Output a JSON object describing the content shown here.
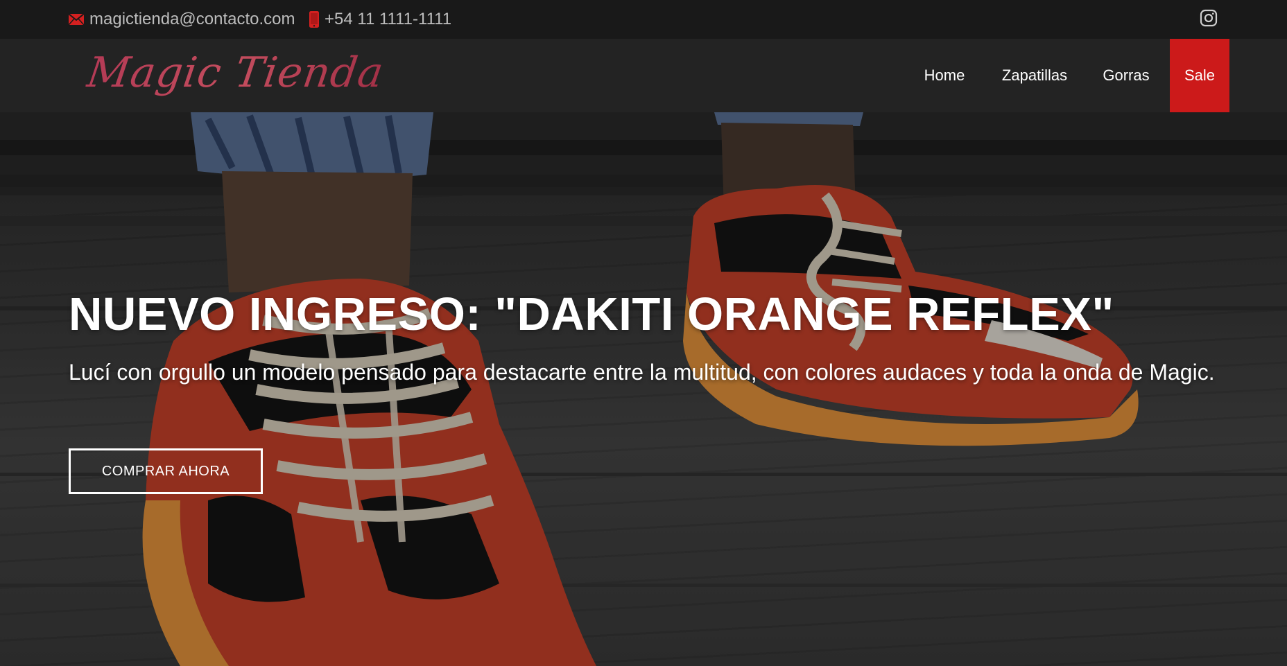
{
  "topbar": {
    "email": "magictienda@contacto.com",
    "phone": "+54 11 1111-1111",
    "icons": {
      "email": "mail-icon",
      "phone": "phone-icon",
      "social": "instagram-icon"
    }
  },
  "brand": {
    "logo_text": "Magic Tienda"
  },
  "nav": {
    "items": [
      {
        "label": "Home"
      },
      {
        "label": "Zapatillas"
      },
      {
        "label": "Gorras"
      },
      {
        "label": "Sale",
        "active": true
      }
    ]
  },
  "hero": {
    "title": "NUEVO INGRESO: \"DAKITI ORANGE REFLEX\"",
    "subtitle": "Lucí con orgullo un modelo pensado para destacarte entre la multitud, con colores audaces y toda la onda de Magic.",
    "cta_label": "COMPRAR AHORA"
  },
  "colors": {
    "accent_red": "#cc1a1a",
    "topbar_bg": "#191919",
    "navbar_bg": "#232323",
    "logo_gradient": "#b33a55",
    "sneaker_orange": "#e06a2a",
    "sneaker_sole": "#e8953c",
    "text_white": "#ffffff",
    "text_muted": "#bdbdbd"
  }
}
